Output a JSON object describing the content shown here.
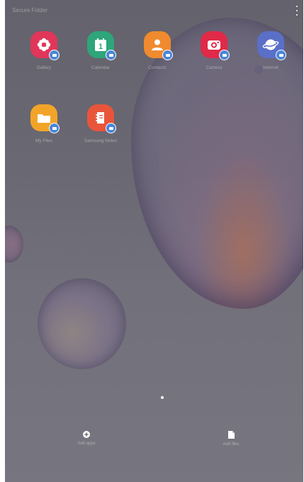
{
  "header": {
    "title": "Secure Folder"
  },
  "apps": [
    {
      "label": "Gallery",
      "icon": "gallery-icon",
      "color": "#e0365a"
    },
    {
      "label": "Calendar",
      "icon": "calendar-icon",
      "color": "#2ea57a"
    },
    {
      "label": "Contacts",
      "icon": "contacts-icon",
      "color": "#f08a2e"
    },
    {
      "label": "Camera",
      "icon": "camera-icon",
      "color": "#e02a48"
    },
    {
      "label": "Internet",
      "icon": "internet-icon",
      "color": "#5a6fc8"
    },
    {
      "label": "My Files",
      "icon": "folder-icon",
      "color": "#f2a429"
    },
    {
      "label": "Samsung Notes",
      "icon": "notes-icon",
      "color": "#e8553a"
    }
  ],
  "calendar_day": "1",
  "bottom": {
    "add_apps_label": "Add apps",
    "add_files_label": "Add files"
  },
  "badge_color": "#4a86d8"
}
